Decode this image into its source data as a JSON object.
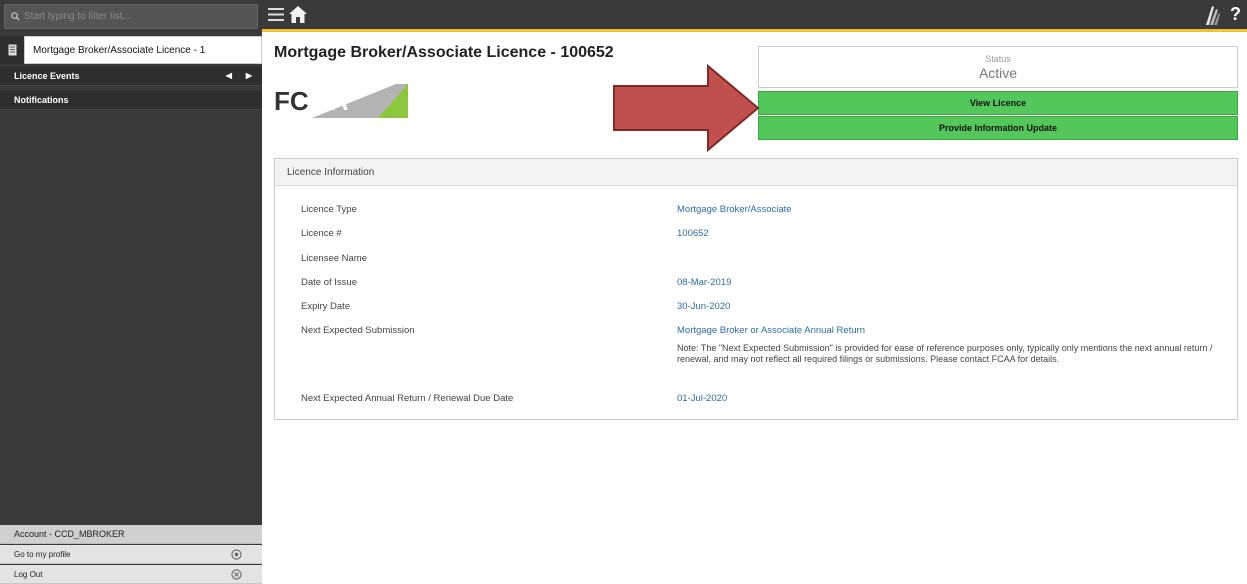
{
  "sidebar": {
    "search_placeholder": "Start typing to filter list...",
    "current_item": "Mortgage Broker/Associate Licence - 1",
    "items": [
      {
        "label": "Licence Events"
      },
      {
        "label": "Notifications"
      }
    ],
    "account_label": "Account - CCD_MBROKER",
    "profile_label": "Go to my profile",
    "logout_label": "Log Out"
  },
  "topbar": {
    "help_label": "?"
  },
  "main": {
    "title": "Mortgage Broker/Associate Licence - 100652",
    "logo_text": "FCAA",
    "status_label": "Status",
    "status_value": "Active",
    "view_button": "View Licence",
    "update_button": "Provide Information Update",
    "panel_title": "Licence Information",
    "fields": [
      {
        "label": "Licence Type",
        "value": "Mortgage Broker/Associate"
      },
      {
        "label": "Licence #",
        "value": "100652"
      },
      {
        "label": "Licensee Name",
        "value": ""
      },
      {
        "label": "Date of Issue",
        "value": "08-Mar-2019"
      },
      {
        "label": "Expiry Date",
        "value": "30-Jun-2020"
      },
      {
        "label": "Next Expected Submission",
        "value": "Mortgage Broker or Associate Annual Return"
      },
      {
        "label": "Next Expected Annual Return / Renewal Due Date",
        "value": "01-Jul-2020"
      }
    ],
    "note": "Note: The \"Next Expected Submission\" is provided for ease of reference purposes only, typically only mentions the next annual return / renewal, and may not reflect all required filings or submissions. Please contact FCAA for details."
  },
  "colors": {
    "accent_green": "#54c75a",
    "topbar_stripe": "#f1c232",
    "link_blue": "#2e6da4",
    "arrow_red": "#c0504d"
  }
}
